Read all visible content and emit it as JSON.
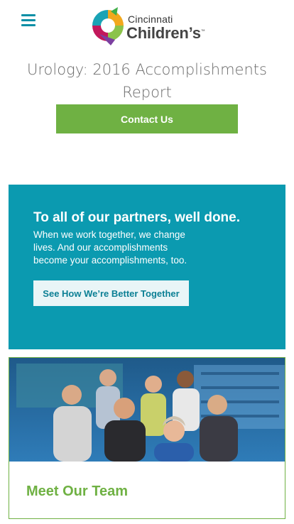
{
  "header": {
    "menu_icon": "hamburger-menu-icon",
    "logo": {
      "small": "Cincinnati",
      "big": "Children’s",
      "tm": "™"
    }
  },
  "page": {
    "title": "Urology: 2016 Accomplishments Report",
    "contact_label": "Contact Us"
  },
  "promo": {
    "heading": "To all of our partners, well done.",
    "body": "When we work together, we change lives. And our accomplishments become your accomplishments, too.",
    "button_label": "See How We’re Better Together"
  },
  "team": {
    "title": "Meet Our Team"
  },
  "colors": {
    "accent_teal": "#0b9ab0",
    "accent_green": "#6fb143",
    "menu_teal": "#0a8fa6"
  }
}
